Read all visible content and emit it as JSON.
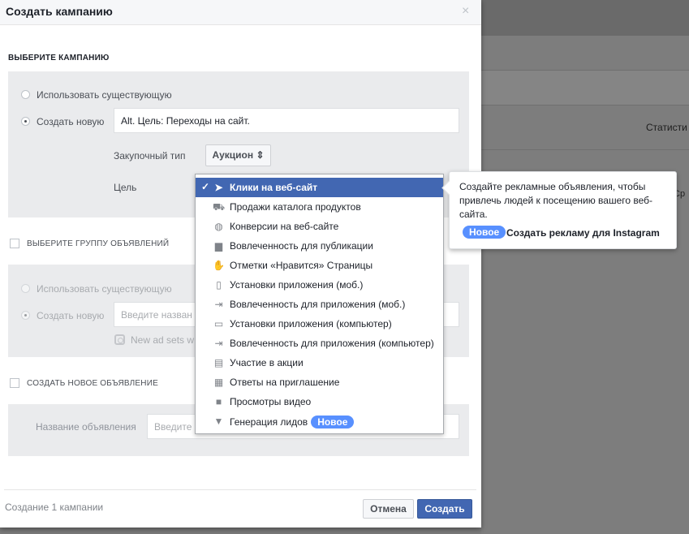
{
  "dialog": {
    "title": "Создать кампанию",
    "close_glyph": "×"
  },
  "campaign": {
    "section_label": "ВЫБЕРИТЕ КАМПАНИЮ",
    "use_existing_label": "Использовать существующую",
    "create_new_label": "Создать новую",
    "name_value": "Alt. Цель: Переходы на сайт.",
    "buying_type_label": "Закупочный тип",
    "buying_type_value": "Аукцион ⇕",
    "objective_label": "Цель"
  },
  "adset": {
    "section_label": "ВЫБЕРИТЕ ГРУППУ ОБЪЯВЛЕНИЙ",
    "use_existing_label": "Использовать существующую",
    "create_new_label": "Создать новую",
    "name_placeholder": "Введите назван",
    "instagram_note": "New ad sets w"
  },
  "ad": {
    "section_label": "СОЗДАТЬ НОВОЕ ОБЪЯВЛЕНИЕ",
    "name_label": "Название объявления",
    "name_placeholder": "Введите"
  },
  "objective_menu": {
    "selected_check": "✓",
    "items": [
      {
        "label": "Клики на веб-сайт",
        "icon": "cursor-icon",
        "selected": true
      },
      {
        "label": "Продажи каталога продуктов",
        "icon": "cart-icon"
      },
      {
        "label": "Конверсии на веб-сайте",
        "icon": "globe-icon"
      },
      {
        "label": "Вовлеченность для публикации",
        "icon": "posts-icon"
      },
      {
        "label": "Отметки «Нравится» Страницы",
        "icon": "thumbs-up-icon"
      },
      {
        "label": "Установки приложения (моб.)",
        "icon": "mobile-install-icon"
      },
      {
        "label": "Вовлеченность для приложения (моб.)",
        "icon": "mobile-engage-icon"
      },
      {
        "label": "Установки приложения (компьютер)",
        "icon": "desktop-install-icon"
      },
      {
        "label": "Вовлеченность для приложения (компьютер)",
        "icon": "desktop-engage-icon"
      },
      {
        "label": "Участие в акции",
        "icon": "offer-icon"
      },
      {
        "label": "Ответы на приглашение",
        "icon": "calendar-icon"
      },
      {
        "label": "Просмотры видео",
        "icon": "video-camera-icon"
      },
      {
        "label": "Генерация лидов",
        "icon": "funnel-icon",
        "badge": "Новое"
      }
    ]
  },
  "tooltip": {
    "text": "Создайте рекламные объявления, чтобы привлечь людей к посещению вашего веб-сайта.",
    "badge": "Новое",
    "link": "Создать рекламу для Instagram"
  },
  "footer": {
    "summary": "Создание 1 кампании",
    "cancel_label": "Отмена",
    "create_label": "Создать"
  },
  "background": {
    "stats_label": "Статисти",
    "partial_label": "Ср"
  },
  "colors": {
    "accent": "#4267b2",
    "badge": "#5890ff"
  }
}
